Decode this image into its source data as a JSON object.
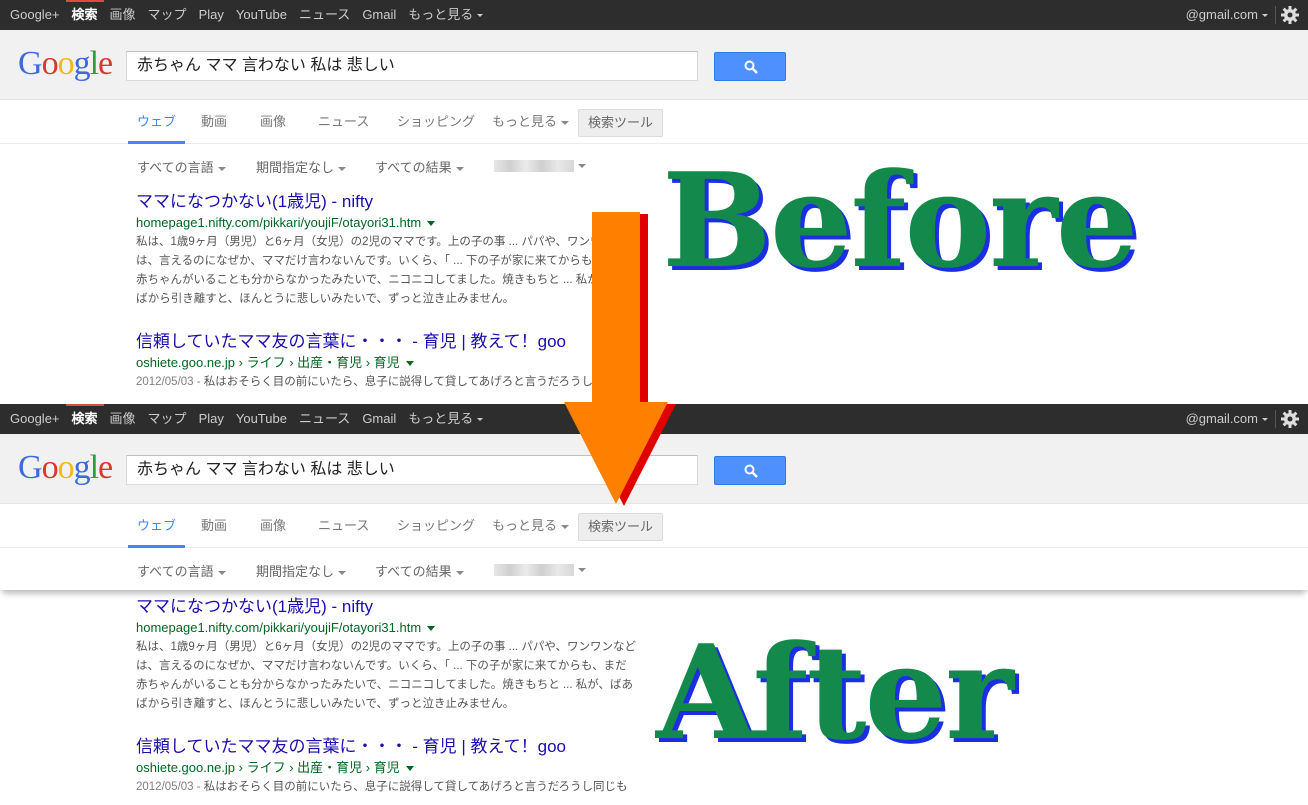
{
  "topbar": {
    "items": [
      "Google+",
      "検索",
      "画像",
      "マップ",
      "Play",
      "YouTube",
      "ニュース",
      "Gmail",
      "もっと見る"
    ],
    "account": "@gmail.com"
  },
  "logo": [
    "G",
    "o",
    "o",
    "g",
    "l",
    "e"
  ],
  "search": {
    "query": "赤ちゃん ママ 言わない 私は 悲しい"
  },
  "tabs": {
    "web": "ウェブ",
    "video": "動画",
    "images": "画像",
    "news": "ニュース",
    "shopping": "ショッピング",
    "more": "もっと見る",
    "tools": "検索ツール"
  },
  "filters": {
    "language": "すべての言語",
    "period": "期間指定なし",
    "results": "すべての結果"
  },
  "results": [
    {
      "title": "ママになつかない(1歳児) - nifty",
      "url": "homepage1.nifty.com/pikkari/youjiF/otayori31.htm",
      "snippet_line1": "私は、1歳9ヶ月（男児）と6ヶ月（女児）の2児のママです。上の子の事 ... パパや、ワンワンなど",
      "snippet_line2": "は、言えるのになぜか、ママだけ言わないんです。いくら、「 ... 下の子が家に来てからも、まだ",
      "snippet_line3": "赤ちゃんがいることも分からなかったみたいで、ニコニコしてました。焼きもちと ... 私が、ばあ",
      "snippet_line4": "ばから引き離すと、ほんとうに悲しいみたいで、ずっと泣き止みません。"
    },
    {
      "title": "信頼していたママ友の言葉に・・・ - 育児 | 教えて！goo",
      "url": "oshiete.goo.ne.jp › ライフ › 出産・育児 › 育児",
      "date": "2012/05/03 - ",
      "snippet": "私はおそらく目の前にいたら、息子に説得して貸してあげろと言うだろうし同じも"
    }
  ],
  "labels": {
    "before": "Before",
    "after": "After"
  },
  "colors": {
    "label_fill": "#138a4b",
    "label_shadow": "#1c2fe0",
    "arrow": "#ff8000",
    "arrow_edge": "#e00000"
  },
  "icons": [
    "search-icon",
    "gear-icon",
    "down-arrow-icon"
  ]
}
